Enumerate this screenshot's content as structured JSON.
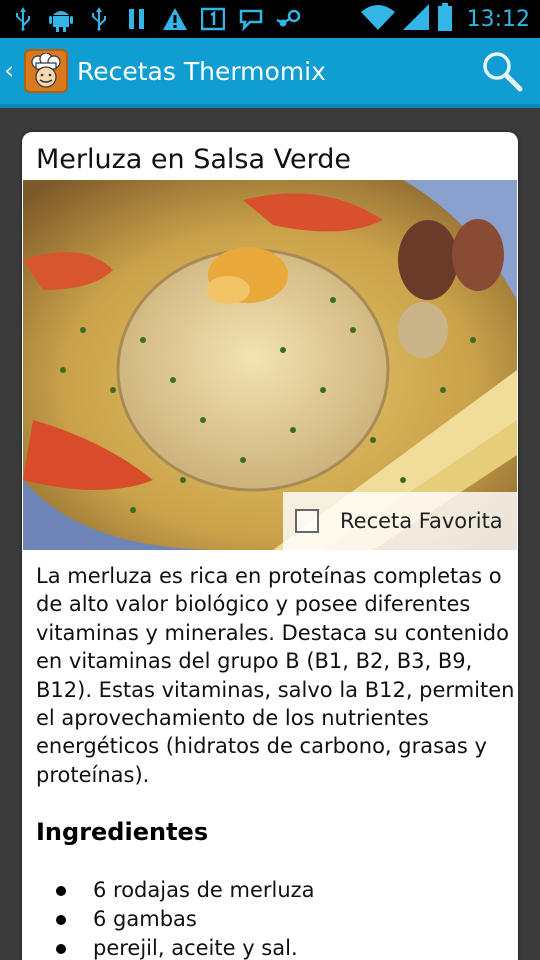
{
  "status_bar": {
    "time": "13:12",
    "icons": [
      "usb-icon",
      "android-debug-icon",
      "usb-icon",
      "pause-icon",
      "warning-icon",
      "sim-one-icon",
      "chat-icon",
      "steam-icon"
    ],
    "accent": "#33b5e5"
  },
  "action_bar": {
    "title": "Recetas Thermomix",
    "background": "#109dd2",
    "icons": [
      "chevron-left-icon",
      "chef-app-icon",
      "search-icon"
    ]
  },
  "recipe": {
    "title": "Merluza en Salsa Verde",
    "favorite_label": "Receta Favorita",
    "favorite_checked": false,
    "description": "La merluza es rica en proteínas completas o de alto valor biológico y posee diferentes vitaminas y minerales. Destaca su contenido en vitaminas del grupo B (B1, B2, B3, B9, B12). Estas vitaminas, salvo la B12, permiten el aprovechamiento de los nutrientes energéticos (hidratos de carbono, grasas y proteínas).",
    "ingredients_heading": "Ingredientes",
    "ingredients": [
      "6 rodajas de merluza",
      "6 gambas",
      "perejil, aceite y sal."
    ]
  }
}
